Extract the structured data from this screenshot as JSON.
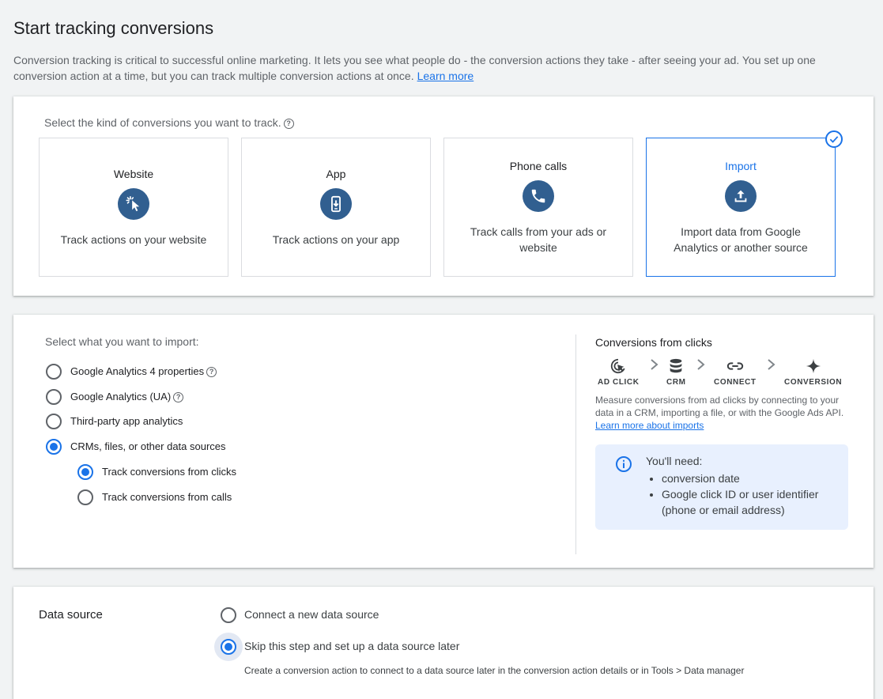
{
  "page": {
    "title": "Start tracking conversions",
    "intro": "Conversion tracking is critical to successful online marketing. It lets you see what people do - the conversion actions they take - after seeing your ad. You set up one conversion action at a time, but you can track multiple conversion actions at once.",
    "learn_more": "Learn more"
  },
  "kind": {
    "prompt": "Select the kind of conversions you want to track.",
    "tiles": [
      {
        "name": "Website",
        "desc": "Track actions on your website",
        "icon": "cursor-click-icon",
        "selected": false
      },
      {
        "name": "App",
        "desc": "Track actions on your app",
        "icon": "mobile-app-icon",
        "selected": false
      },
      {
        "name": "Phone calls",
        "desc": "Track calls from your ads or website",
        "icon": "phone-icon",
        "selected": false
      },
      {
        "name": "Import",
        "desc": "Import data from Google Analytics or another source",
        "icon": "upload-icon",
        "selected": true
      }
    ]
  },
  "import": {
    "prompt": "Select what you want to import:",
    "options": [
      {
        "label": "Google Analytics 4 properties",
        "selected": false,
        "help": true
      },
      {
        "label": "Google Analytics (UA)",
        "selected": false,
        "help": true
      },
      {
        "label": "Third-party app analytics",
        "selected": false,
        "help": false
      },
      {
        "label": "CRMs, files, or other data sources",
        "selected": true,
        "help": false
      }
    ],
    "sub_options": [
      {
        "label": "Track conversions from clicks",
        "selected": true
      },
      {
        "label": "Track conversions from calls",
        "selected": false
      }
    ]
  },
  "clicks_panel": {
    "title": "Conversions from clicks",
    "steps": [
      {
        "label": "AD CLICK",
        "icon": "ad-click-icon"
      },
      {
        "label": "CRM",
        "icon": "database-icon"
      },
      {
        "label": "CONNECT",
        "icon": "link-icon"
      },
      {
        "label": "CONVERSION",
        "icon": "sparkle-icon"
      }
    ],
    "desc": "Measure conversions from ad clicks by connecting to your data in a CRM, importing a file, or with the Google Ads API.",
    "link": "Learn more about imports",
    "need": {
      "heading": "You'll need:",
      "items": [
        "conversion date",
        "Google click ID or user identifier (phone or email address)"
      ]
    }
  },
  "data_source": {
    "label": "Data source",
    "options": [
      {
        "label": "Connect a new data source",
        "selected": false
      },
      {
        "label": "Skip this step and set up a data source later",
        "selected": true
      }
    ],
    "note": "Create a conversion action to connect to a data source later in the conversion action details or in Tools > Data manager"
  },
  "colors": {
    "accent": "#1a73e8",
    "icon_bg": "#315f90",
    "info_bg": "#e8f0fe"
  }
}
